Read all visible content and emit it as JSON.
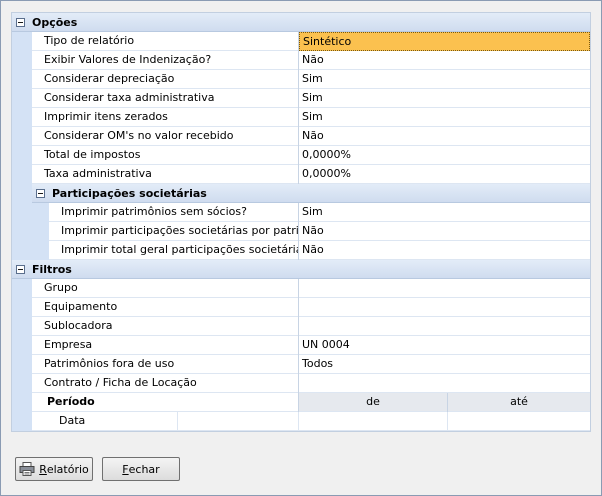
{
  "sections": {
    "opcoes": {
      "title": "Opções",
      "rows": [
        {
          "label": "Tipo de relatório",
          "value": "Sintético"
        },
        {
          "label": "Exibir Valores de Indenização?",
          "value": "Não"
        },
        {
          "label": "Considerar depreciação",
          "value": "Sim"
        },
        {
          "label": "Considerar taxa administrativa",
          "value": "Sim"
        },
        {
          "label": "Imprimir itens zerados",
          "value": "Sim"
        },
        {
          "label": "Considerar OM's no valor recebido",
          "value": "Não"
        },
        {
          "label": "Total de impostos",
          "value": "0,0000%"
        },
        {
          "label": "Taxa administrativa",
          "value": "0,0000%"
        }
      ],
      "sub": {
        "title": "Participações societárias",
        "rows": [
          {
            "label": "Imprimir patrimônios sem sócios?",
            "value": "Sim"
          },
          {
            "label": "Imprimir participações societárias por patrimônio",
            "value": "Não"
          },
          {
            "label": "Imprimir total geral participações societárias",
            "value": "Não"
          }
        ]
      }
    },
    "filtros": {
      "title": "Filtros",
      "rows": [
        {
          "label": "Grupo",
          "value": ""
        },
        {
          "label": "Equipamento",
          "value": ""
        },
        {
          "label": "Sublocadora",
          "value": ""
        },
        {
          "label": "Empresa",
          "value": "UN 0004"
        },
        {
          "label": "Patrimônios fora de uso",
          "value": "Todos"
        },
        {
          "label": "Contrato / Ficha de Locação",
          "value": ""
        }
      ],
      "periodo": {
        "label": "Período",
        "col_from": "de",
        "col_to": "até",
        "date_label": "Data",
        "date_from": "",
        "date_to": ""
      }
    }
  },
  "buttons": {
    "report_first": "R",
    "report_rest": "elatório",
    "close_first": "F",
    "close_rest": "echar"
  },
  "icons": {
    "report": "printer-icon",
    "expander": "collapse-icon"
  },
  "colors": {
    "selection": "#fbc14f",
    "category": "#d4e2f5"
  }
}
